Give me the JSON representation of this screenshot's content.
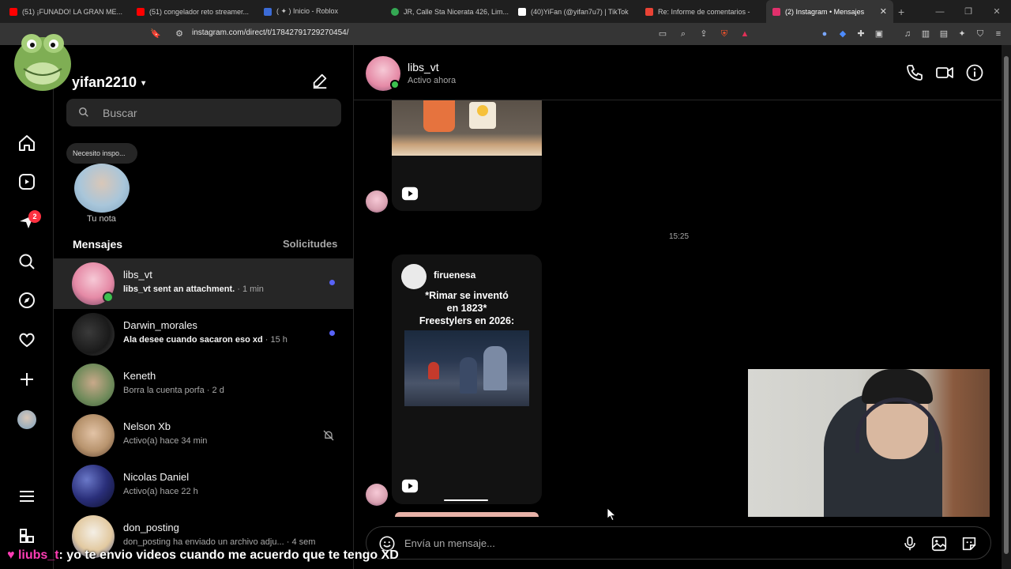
{
  "browser": {
    "tabs": [
      {
        "label": "(51) ¡FUNADO! LA GRAN ME...",
        "icon": "youtube-icon",
        "color": "#ff0000"
      },
      {
        "label": "(51) congelador reto streamer...",
        "icon": "youtube-icon",
        "color": "#ff0000"
      },
      {
        "label": "( ✦ ) Inicio - Roblox",
        "icon": "roblox-icon",
        "color": "#3b6bd6"
      },
      {
        "label": "JR, Calle Sta Nicerata 426, Lim...",
        "icon": "maps-pin-icon",
        "color": "#34a853"
      },
      {
        "label": "(40)YiFan (@yifan7u7) | TikTok",
        "icon": "tiktok-icon",
        "color": "#ffffff"
      },
      {
        "label": "Re: Informe de comentarios -",
        "icon": "gmail-icon",
        "color": "#ea4335"
      },
      {
        "label": "(2) Instagram • Mensajes",
        "icon": "instagram-icon",
        "color": "#e1306c",
        "active": true
      }
    ],
    "address": "instagram.com/direct/t/17842791729270454/"
  },
  "sidebar_nav": {
    "notifications_badge": "2",
    "items": [
      "home-icon",
      "reels-icon",
      "messages-icon",
      "search-icon",
      "explore-icon",
      "heart-icon",
      "create-icon",
      "profile-icon",
      "more-icon",
      "apps-icon"
    ]
  },
  "inbox": {
    "username": "yifan2210",
    "search_placeholder": "Buscar",
    "note_text": "Necesito inspo...",
    "note_label": "Tu nota",
    "messages_heading": "Mensajes",
    "requests_heading": "Solicitudes",
    "conversations": [
      {
        "name": "libs_vt",
        "preview": "libs_vt sent an attachment.",
        "time": "· 1 min",
        "unread": true,
        "online": true,
        "selected": true
      },
      {
        "name": "Darwin_morales",
        "preview": "Ala desee cuando sacaron eso xd",
        "time": "· 15 h",
        "unread": true
      },
      {
        "name": "Keneth",
        "preview": "Borra la cuenta porfa",
        "time": "· 2 d",
        "unread": false
      },
      {
        "name": "Nelson Xb",
        "preview": "Activo(a) hace 34 min",
        "time": "",
        "muted": true
      },
      {
        "name": "Nicolas Daniel",
        "preview": "Activo(a) hace 22 h",
        "time": ""
      },
      {
        "name": "don_posting",
        "preview": "don_posting ha enviado un archivo adju...",
        "time": "· 4 sem"
      }
    ]
  },
  "chat": {
    "name": "libs_vt",
    "status": "Activo ahora",
    "timestamp": "15:25",
    "reel_author": "firuenesa",
    "reel_caption_1": "*Rimar se inventó",
    "reel_caption_2": "en 1823*",
    "reel_caption_3": "Freestylers en 2026:",
    "composer_placeholder": "Envía un mensaje..."
  },
  "stream_overlay": {
    "user": "liubs_t",
    "message": ": yo te envio videos cuando me acuerdo que te tengo XD"
  }
}
